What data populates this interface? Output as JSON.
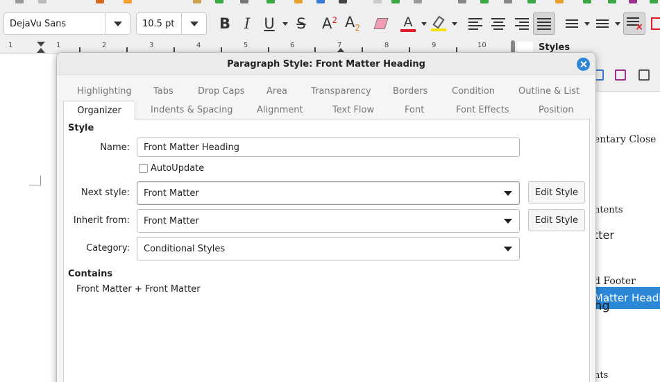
{
  "toolbar": {
    "font_name": "DejaVu Sans",
    "font_size": "10.5 pt",
    "bold_glyph": "B",
    "italic_glyph": "I",
    "underline_glyph": "U",
    "strike_glyph": "S",
    "superscript_glyph": "A",
    "superscript_mark": "2",
    "subscript_glyph": "A",
    "subscript_mark": "2",
    "font_color_glyph": "A",
    "colors": {
      "font_color": "#e01b24",
      "highlight": "#f5e400",
      "accent": "#2b88d9"
    }
  },
  "ruler": {
    "numbers": [
      "1",
      "1",
      "2",
      "3",
      "4",
      "5",
      "6",
      "7",
      "8",
      "9",
      "10"
    ]
  },
  "sidebar": {
    "title": "Styles",
    "visible_styles": [
      "entary Close",
      "ntents",
      "tter",
      "Matter Heading",
      "d Footer",
      "ng",
      "nts"
    ],
    "selected": "Matter Heading"
  },
  "dialog": {
    "title": "Paragraph Style: Front Matter Heading",
    "tabs_row1": [
      "Highlighting",
      "Tabs",
      "Drop Caps",
      "Area",
      "Transparency",
      "Borders",
      "Condition",
      "Outline & List"
    ],
    "tabs_row2": [
      "Organizer",
      "Indents & Spacing",
      "Alignment",
      "Text Flow",
      "Font",
      "Font Effects",
      "Position"
    ],
    "active_tab": "Organizer",
    "style_section": "Style",
    "name_label": "Name:",
    "name_value": "Front Matter Heading",
    "autoupdate_label": "AutoUpdate",
    "autoupdate_checked": false,
    "next_style_label": "Next style:",
    "next_style_value": "Front Matter",
    "inherit_label": "Inherit from:",
    "inherit_value": "Front Matter",
    "category_label": "Category:",
    "category_value": "Conditional Styles",
    "edit_style_label": "Edit Style",
    "contains_section": "Contains",
    "contains_value": "Front Matter + Front Matter"
  }
}
